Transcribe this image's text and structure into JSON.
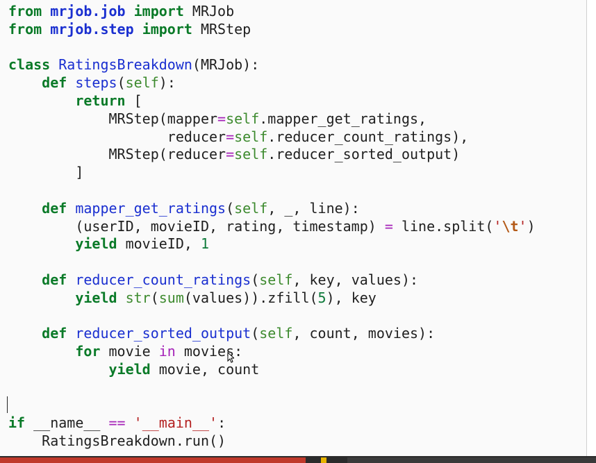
{
  "editor": {
    "lines": [
      [
        {
          "t": "from",
          "c": "kw"
        },
        {
          "t": " ",
          "c": "pl"
        },
        {
          "t": "mrjob.job",
          "c": "mod"
        },
        {
          "t": " ",
          "c": "pl"
        },
        {
          "t": "import",
          "c": "kw"
        },
        {
          "t": " MRJob",
          "c": "pl"
        }
      ],
      [
        {
          "t": "from",
          "c": "kw"
        },
        {
          "t": " ",
          "c": "pl"
        },
        {
          "t": "mrjob.step",
          "c": "mod"
        },
        {
          "t": " ",
          "c": "pl"
        },
        {
          "t": "import",
          "c": "kw"
        },
        {
          "t": " MRStep",
          "c": "pl"
        }
      ],
      [],
      [
        {
          "t": "class",
          "c": "kw"
        },
        {
          "t": " ",
          "c": "pl"
        },
        {
          "t": "RatingsBreakdown",
          "c": "cls"
        },
        {
          "t": "(MRJob):",
          "c": "pl"
        }
      ],
      [
        {
          "t": "    ",
          "c": "pl"
        },
        {
          "t": "def",
          "c": "kw"
        },
        {
          "t": " ",
          "c": "pl"
        },
        {
          "t": "steps",
          "c": "fn"
        },
        {
          "t": "(",
          "c": "pl"
        },
        {
          "t": "self",
          "c": "self"
        },
        {
          "t": "):",
          "c": "pl"
        }
      ],
      [
        {
          "t": "        ",
          "c": "pl"
        },
        {
          "t": "return",
          "c": "kw"
        },
        {
          "t": " [",
          "c": "pl"
        }
      ],
      [
        {
          "t": "            MRStep(mapper",
          "c": "pl"
        },
        {
          "t": "=",
          "c": "op"
        },
        {
          "t": "self",
          "c": "self"
        },
        {
          "t": ".mapper_get_ratings,",
          "c": "pl"
        }
      ],
      [
        {
          "t": "                   reducer",
          "c": "pl"
        },
        {
          "t": "=",
          "c": "op"
        },
        {
          "t": "self",
          "c": "self"
        },
        {
          "t": ".reducer_count_ratings),",
          "c": "pl"
        }
      ],
      [
        {
          "t": "            MRStep(reducer",
          "c": "pl"
        },
        {
          "t": "=",
          "c": "op"
        },
        {
          "t": "self",
          "c": "self"
        },
        {
          "t": ".reducer_sorted_output)",
          "c": "pl"
        }
      ],
      [
        {
          "t": "        ]",
          "c": "pl"
        }
      ],
      [],
      [
        {
          "t": "    ",
          "c": "pl"
        },
        {
          "t": "def",
          "c": "kw"
        },
        {
          "t": " ",
          "c": "pl"
        },
        {
          "t": "mapper_get_ratings",
          "c": "fn"
        },
        {
          "t": "(",
          "c": "pl"
        },
        {
          "t": "self",
          "c": "self"
        },
        {
          "t": ", _, line):",
          "c": "pl"
        }
      ],
      [
        {
          "t": "        (userID, movieID, rating, timestamp) ",
          "c": "pl"
        },
        {
          "t": "=",
          "c": "op"
        },
        {
          "t": " line.split(",
          "c": "pl"
        },
        {
          "t": "'",
          "c": "str"
        },
        {
          "t": "\\t",
          "c": "esc"
        },
        {
          "t": "'",
          "c": "str"
        },
        {
          "t": ")",
          "c": "pl"
        }
      ],
      [
        {
          "t": "        ",
          "c": "pl"
        },
        {
          "t": "yield",
          "c": "kw"
        },
        {
          "t": " movieID, ",
          "c": "pl"
        },
        {
          "t": "1",
          "c": "num"
        }
      ],
      [],
      [
        {
          "t": "    ",
          "c": "pl"
        },
        {
          "t": "def",
          "c": "kw"
        },
        {
          "t": " ",
          "c": "pl"
        },
        {
          "t": "reducer_count_ratings",
          "c": "fn"
        },
        {
          "t": "(",
          "c": "pl"
        },
        {
          "t": "self",
          "c": "self"
        },
        {
          "t": ", key, values):",
          "c": "pl"
        }
      ],
      [
        {
          "t": "        ",
          "c": "pl"
        },
        {
          "t": "yield",
          "c": "kw"
        },
        {
          "t": " ",
          "c": "pl"
        },
        {
          "t": "str",
          "c": "self"
        },
        {
          "t": "(",
          "c": "pl"
        },
        {
          "t": "sum",
          "c": "self"
        },
        {
          "t": "(values)).zfill(",
          "c": "pl"
        },
        {
          "t": "5",
          "c": "num"
        },
        {
          "t": "), key",
          "c": "pl"
        }
      ],
      [],
      [
        {
          "t": "    ",
          "c": "pl"
        },
        {
          "t": "def",
          "c": "kw"
        },
        {
          "t": " ",
          "c": "pl"
        },
        {
          "t": "reducer_sorted_output",
          "c": "fn"
        },
        {
          "t": "(",
          "c": "pl"
        },
        {
          "t": "self",
          "c": "self"
        },
        {
          "t": ", count, movies):",
          "c": "pl"
        }
      ],
      [
        {
          "t": "        ",
          "c": "pl"
        },
        {
          "t": "for",
          "c": "kw"
        },
        {
          "t": " movie ",
          "c": "pl"
        },
        {
          "t": "in",
          "c": "op"
        },
        {
          "t": " movies:",
          "c": "pl"
        }
      ],
      [
        {
          "t": "            ",
          "c": "pl"
        },
        {
          "t": "yield",
          "c": "kw"
        },
        {
          "t": " movie, count",
          "c": "pl"
        }
      ],
      [],
      [],
      [
        {
          "t": "if",
          "c": "kw"
        },
        {
          "t": " __name__ ",
          "c": "pl"
        },
        {
          "t": "==",
          "c": "op"
        },
        {
          "t": " ",
          "c": "pl"
        },
        {
          "t": "'__main__'",
          "c": "str"
        },
        {
          "t": ":",
          "c": "pl"
        }
      ],
      [
        {
          "t": "    RatingsBreakdown.run()",
          "c": "pl"
        }
      ]
    ]
  },
  "colors": {
    "keyword": "#0a7a28",
    "module": "#1a2fd0",
    "function": "#1a2fd0",
    "builtin_self": "#3d8a2e",
    "operator": "#a523b8",
    "string": "#b42121",
    "number": "#0e7a3a",
    "background": "#fafafa"
  },
  "icons": {
    "mouse_pointer": "arrow-cursor-icon"
  }
}
